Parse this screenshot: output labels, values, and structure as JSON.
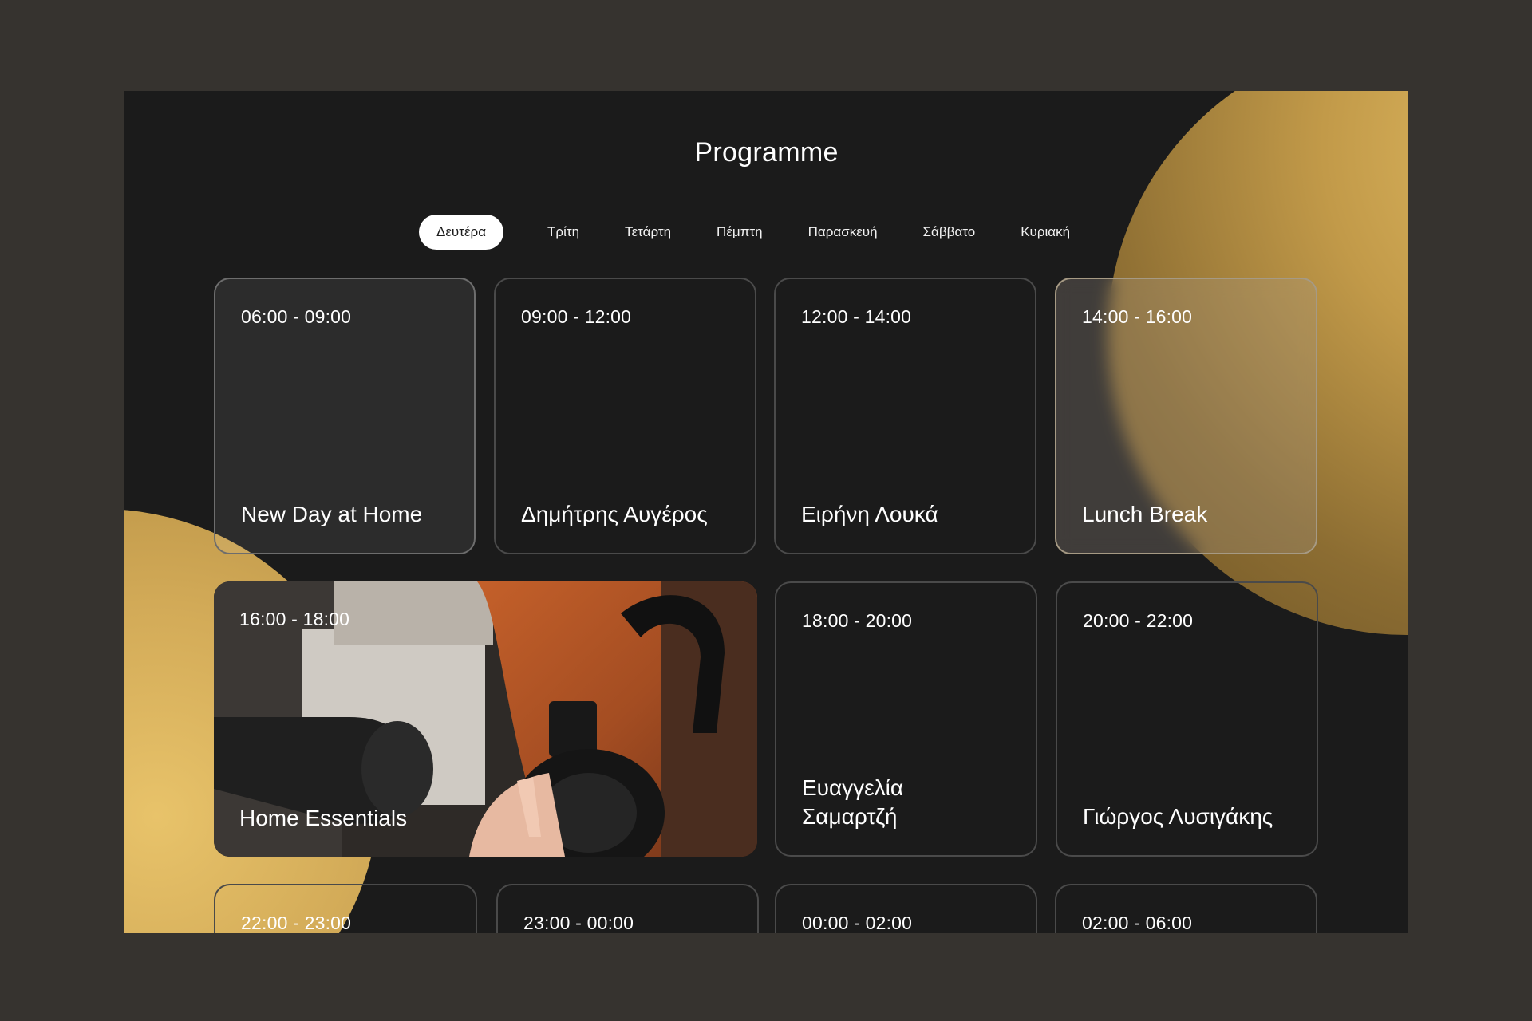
{
  "page": {
    "title": "Programme"
  },
  "days": [
    {
      "label": "Δευτέρα",
      "active": true
    },
    {
      "label": "Τρίτη",
      "active": false
    },
    {
      "label": "Τετάρτη",
      "active": false
    },
    {
      "label": "Πέμπτη",
      "active": false
    },
    {
      "label": "Παρασκευή",
      "active": false
    },
    {
      "label": "Σάββατο",
      "active": false
    },
    {
      "label": "Κυριακή",
      "active": false
    }
  ],
  "shows": [
    {
      "time": "06:00 - 09:00",
      "name": "New Day at Home"
    },
    {
      "time": "09:00 - 12:00",
      "name": "Δημήτρης Αυγέρος"
    },
    {
      "time": "12:00 - 14:00",
      "name": "Ειρήνη Λουκά"
    },
    {
      "time": "14:00 - 16:00",
      "name": "Lunch Break"
    },
    {
      "time": "16:00 - 18:00",
      "name": "Home Essentials"
    },
    {
      "time": "18:00 - 20:00",
      "name": "Ευαγγελία Σαμαρτζή"
    },
    {
      "time": "20:00 - 22:00",
      "name": "Γιώργος Λυσιγάκης"
    },
    {
      "time": "22:00 - 23:00",
      "name": ""
    },
    {
      "time": "23:00 - 00:00",
      "name": ""
    },
    {
      "time": "00:00 - 02:00",
      "name": ""
    },
    {
      "time": "02:00 - 06:00",
      "name": ""
    }
  ],
  "colors": {
    "background": "#36332f",
    "screen": "#1b1b1b",
    "accent_gold": "#d8b25c",
    "text": "#ffffff"
  }
}
